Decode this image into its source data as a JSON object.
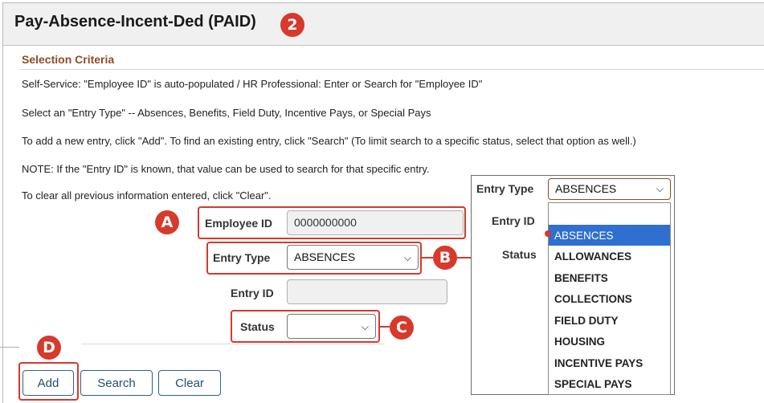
{
  "page": {
    "title": "Pay-Absence-Incent-Ded (PAID)",
    "title_badge": "2"
  },
  "selection": {
    "heading": "Selection Criteria",
    "instructions": [
      "Self-Service: \"Employee ID\" is auto-populated / HR Professional: Enter or Search for \"Employee ID\"",
      "Select an \"Entry Type\" -- Absences, Benefits, Field Duty, Incentive Pays, or Special Pays",
      "To add a new entry, click \"Add\". To find an existing entry, click \"Search\" (To limit search to a specific status, select that option as well.)",
      "NOTE: If the \"Entry ID\" is known, that value can be used to search for that specific entry.",
      "To clear all previous information entered, click \"Clear\"."
    ]
  },
  "form": {
    "employee_id_label": "Employee ID",
    "employee_id_value": "0000000000",
    "entry_type_label": "Entry Type",
    "entry_type_value": "ABSENCES",
    "entry_id_label": "Entry ID",
    "entry_id_value": "",
    "status_label": "Status",
    "status_value": ""
  },
  "buttons": {
    "add": "Add",
    "search": "Search",
    "clear": "Clear"
  },
  "callouts": {
    "a": "A",
    "b": "B",
    "c": "C",
    "d": "D"
  },
  "dropdown_overlay": {
    "entry_type_label": "Entry Type",
    "entry_type_value": "ABSENCES",
    "entry_id_label": "Entry ID",
    "status_label": "Status",
    "options": [
      "ABSENCES",
      "ALLOWANCES",
      "BENEFITS",
      "COLLECTIONS",
      "FIELD DUTY",
      "HOUSING",
      "INCENTIVE PAYS",
      "SPECIAL PAYS"
    ],
    "selected_option": "ABSENCES"
  },
  "colors": {
    "callout_red": "#d7392c",
    "section_heading": "#8e4b22",
    "button_text": "#1f4e79",
    "selected_option_bg": "#2f6fd0"
  }
}
